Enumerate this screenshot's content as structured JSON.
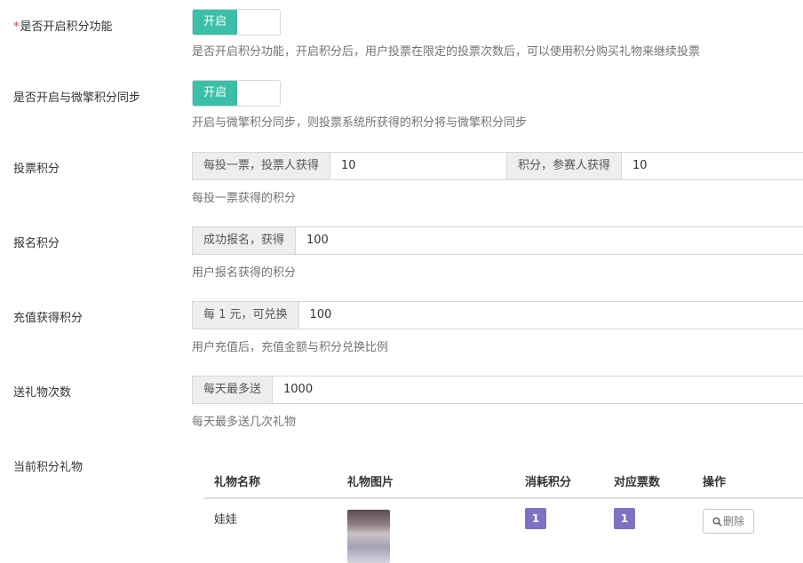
{
  "settings": {
    "enable_points": {
      "required_mark": "*",
      "label": "是否开启积分功能",
      "toggle_text": "开启",
      "help": "是否开启积分功能，开启积分后，用户投票在限定的投票次数后，可以使用积分购买礼物来继续投票"
    },
    "sync_weiqing": {
      "label": "是否开启与微擎积分同步",
      "toggle_text": "开启",
      "help": "开启与微擎积分同步，则投票系统所获得的积分将与微擎积分同步"
    },
    "vote_points": {
      "label": "投票积分",
      "addon_voter": "每投一票，投票人获得",
      "voter_value": "10",
      "addon_contestant": "积分，参赛人获得",
      "contestant_value": "10",
      "help": "每投一票获得的积分"
    },
    "signup_points": {
      "label": "报名积分",
      "addon": "成功报名，获得",
      "value": "100",
      "help": "用户报名获得的积分"
    },
    "recharge_points": {
      "label": "充值获得积分",
      "addon": "每 1 元，可兑换",
      "value": "100",
      "help": "用户充值后，充值金额与积分兑换比例"
    },
    "gift_times": {
      "label": "送礼物次数",
      "addon": "每天最多送",
      "value": "1000",
      "help": "每天最多送几次礼物"
    },
    "current_gifts": {
      "label": "当前积分礼物"
    }
  },
  "gift_table": {
    "headers": [
      "礼物名称",
      "礼物图片",
      "消耗积分",
      "对应票数",
      "操作"
    ],
    "rows": [
      {
        "name": "娃娃",
        "cost_points": "1",
        "votes": "1",
        "action_label": "删除"
      }
    ]
  },
  "colors": {
    "toggle_on": "#3bbfa8",
    "badge": "#7f72c5",
    "required": "#e4393c"
  }
}
